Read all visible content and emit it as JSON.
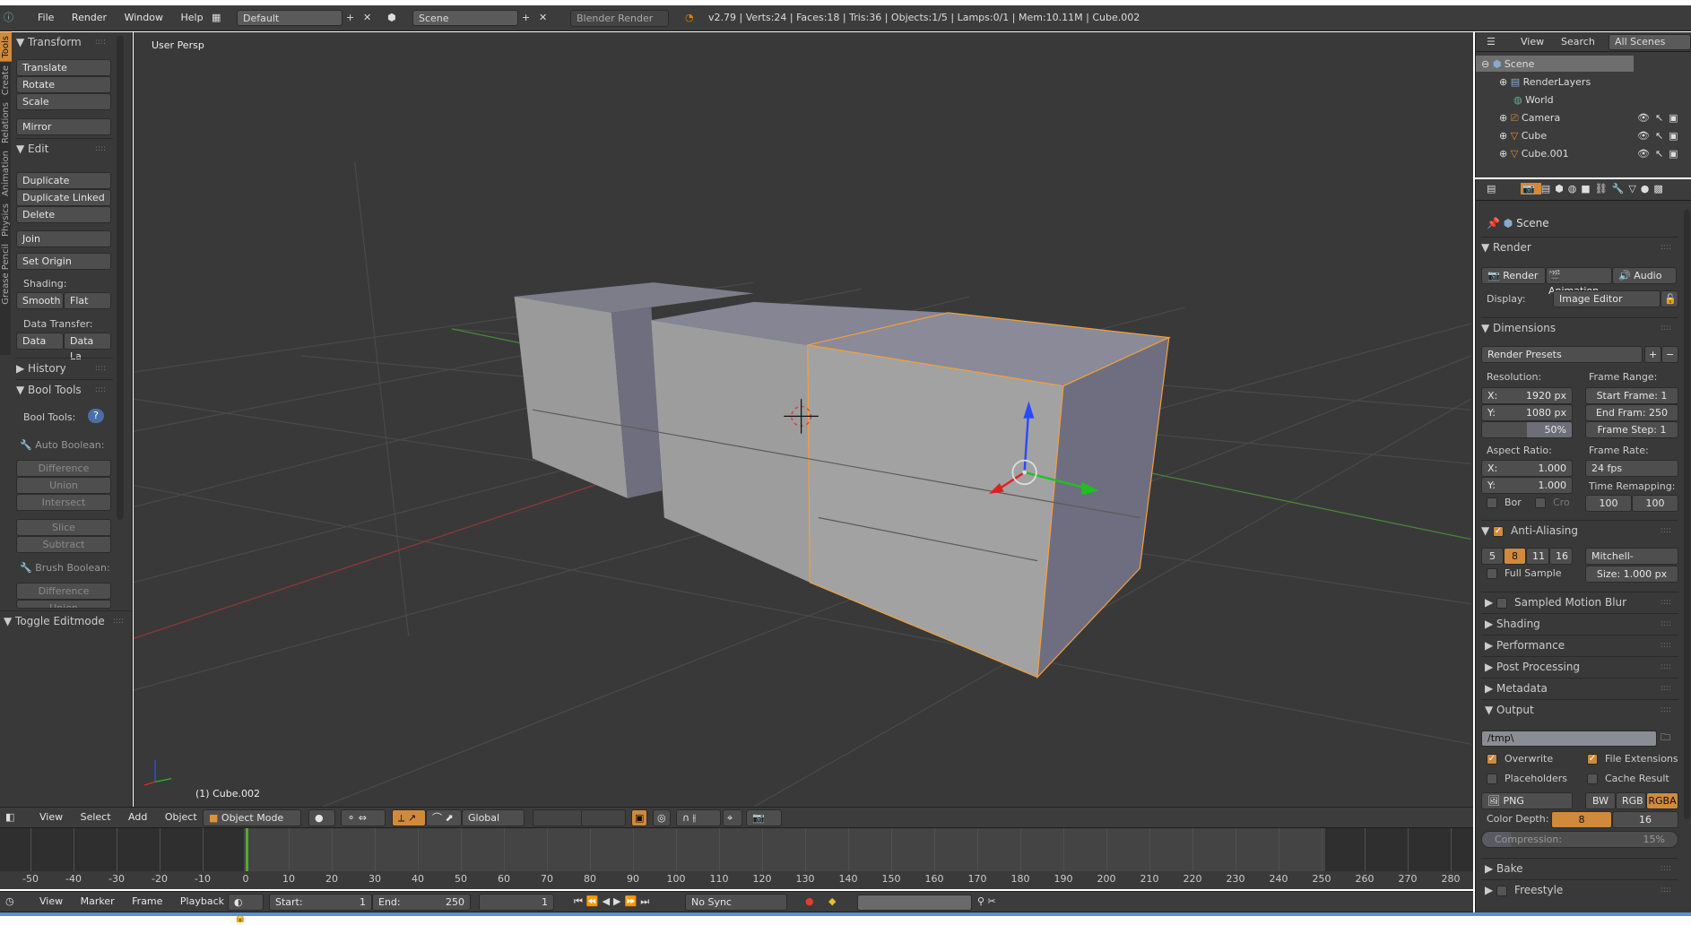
{
  "topbar": {
    "menus": [
      "File",
      "Render",
      "Window",
      "Help"
    ],
    "layout": "Default",
    "scene": "Scene",
    "engine": "Blender Render",
    "stats": "v2.79 | Verts:24 | Faces:18 | Tris:36 | Objects:1/5 | Lamps:0/1 | Mem:10.11M | Cube.002"
  },
  "toolshelf": {
    "tabs": [
      "Tools",
      "Create",
      "Relations",
      "Animation",
      "Physics",
      "Grease Pencil"
    ],
    "transform": {
      "title": "Transform",
      "items": [
        "Translate",
        "Rotate",
        "Scale",
        "Mirror"
      ]
    },
    "edit": {
      "title": "Edit",
      "items": [
        "Duplicate",
        "Duplicate Linked",
        "Delete",
        "Join",
        "Set Origin"
      ],
      "shading_label": "Shading:",
      "smooth": "Smooth",
      "flat": "Flat",
      "data_transfer_label": "Data Transfer:",
      "data": "Data",
      "data_layers": "Data La"
    },
    "history": "History",
    "bool": {
      "title": "Bool Tools",
      "label": "Bool Tools:",
      "auto": "Auto Boolean:",
      "auto_items": [
        "Difference",
        "Union",
        "Intersect",
        "Slice",
        "Subtract"
      ],
      "brush": "Brush Boolean:",
      "brush_items": [
        "Difference",
        "Union"
      ]
    },
    "toggle_editmode": "Toggle Editmode"
  },
  "viewport": {
    "view_label": "User Persp",
    "object_label": "(1) Cube.002",
    "header": {
      "menus": [
        "View",
        "Select",
        "Add",
        "Object"
      ],
      "mode": "Object Mode",
      "orientation": "Global"
    }
  },
  "timeline": {
    "ticks": [
      "-50",
      "-40",
      "-30",
      "-20",
      "-10",
      "0",
      "10",
      "20",
      "30",
      "40",
      "50",
      "60",
      "70",
      "80",
      "90",
      "100",
      "110",
      "120",
      "130",
      "140",
      "150",
      "160",
      "170",
      "180",
      "190",
      "200",
      "210",
      "220",
      "230",
      "240",
      "250",
      "260",
      "270",
      "280"
    ],
    "current_frame": 1,
    "menus": [
      "View",
      "Marker",
      "Frame",
      "Playback"
    ],
    "start_label": "Start:",
    "start": "1",
    "end_label": "End:",
    "end": "250",
    "frame": "1",
    "sync": "No Sync"
  },
  "outliner": {
    "menus": [
      "View",
      "Search"
    ],
    "filter": "All Scenes",
    "items": [
      "Scene",
      "RenderLayers",
      "World",
      "Camera",
      "Cube",
      "Cube.001"
    ]
  },
  "properties": {
    "context": "Scene",
    "render": {
      "title": "Render",
      "render": "Render",
      "animation": "Animation",
      "audio": "Audio",
      "display_label": "Display:",
      "display": "Image Editor"
    },
    "dimensions": {
      "title": "Dimensions",
      "presets": "Render Presets",
      "resolution": "Resolution:",
      "res_x": "X:",
      "res_x_val": "1920 px",
      "res_y": "Y:",
      "res_y_val": "1080 px",
      "res_pct": "50%",
      "frame_range": "Frame Range:",
      "start": "Start Frame: 1",
      "end": "End Fram: 250",
      "step": "Frame Step: 1",
      "aspect": "Aspect Ratio:",
      "asp_x": "1.000",
      "asp_y": "1.000",
      "frame_rate": "Frame Rate:",
      "fps": "24 fps",
      "remap": "Time Remapping:",
      "remap_old": "100",
      "remap_new": "100",
      "border": "Bor",
      "crop": "Cro"
    },
    "aa": {
      "title": "Anti-Aliasing",
      "samples": [
        "5",
        "8",
        "11",
        "16"
      ],
      "selected": "8",
      "filter": "Mitchell-Netrav...",
      "full_sample": "Full Sample",
      "size": "Size: 1.000 px"
    },
    "collapsed": [
      "Sampled Motion Blur",
      "Shading",
      "Performance",
      "Post Processing",
      "Metadata"
    ],
    "output": {
      "title": "Output",
      "path": "/tmp\\",
      "overwrite": "Overwrite",
      "file_ext": "File Extensions",
      "placeholders": "Placeholders",
      "cache": "Cache Result",
      "format": "PNG",
      "modes": [
        "BW",
        "RGB",
        "RGBA"
      ],
      "mode_selected": "RGBA",
      "depth_label": "Color Depth:",
      "depths": [
        "8",
        "16"
      ],
      "compression": "Compression:",
      "compression_val": "15%"
    },
    "bake": "Bake",
    "freestyle": "Freestyle"
  },
  "colors": {
    "accent": "#d08a3c",
    "bg": "#393939",
    "selected_outline": "#f0a040",
    "frame_cursor": "#4caf30"
  }
}
